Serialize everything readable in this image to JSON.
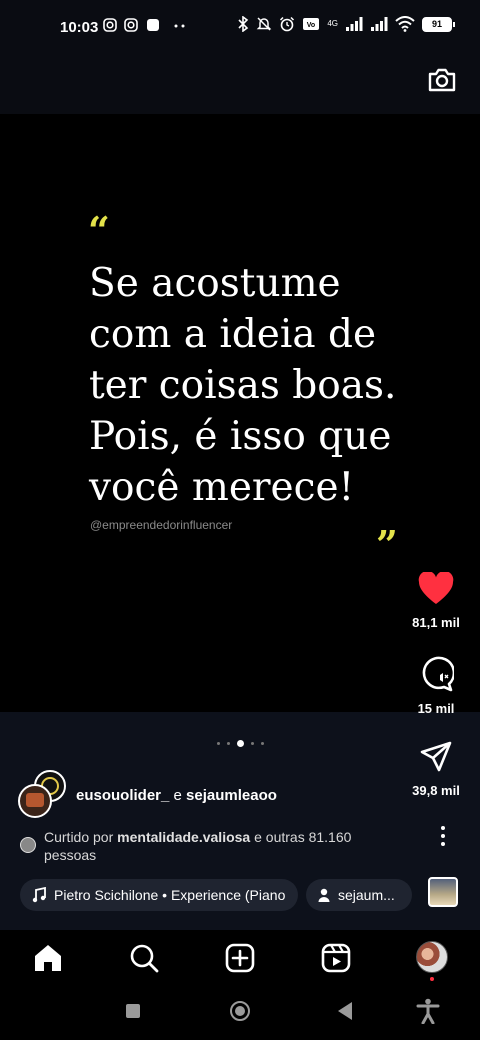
{
  "status_bar": {
    "time": "10:03",
    "network": "4G",
    "battery": "91",
    "icons": [
      "instagram-icon",
      "instagram-icon",
      "app-square-icon",
      "more-dots-icon",
      "bluetooth-icon",
      "silent-icon",
      "alarm-icon",
      "volte-icon",
      "signal-icon",
      "signal-icon",
      "wifi-icon",
      "battery-icon"
    ]
  },
  "post": {
    "quote_text": "Se acostume com a ideia de ter coisas boas. Pois, é isso que você merece!",
    "quote_open": "“",
    "quote_close": "”",
    "handle": "@empreendedorinfluencer",
    "accent_color": "#e3e24a"
  },
  "actions": {
    "likes": "81,1 mil",
    "comments": "15 mil",
    "shares": "39,8 mil",
    "like_color": "#ff3040"
  },
  "carousel": {
    "count": 5,
    "active_index": 2
  },
  "authors": {
    "first": "eusouolider_",
    "connector": "e",
    "second": "sejaumleaoo"
  },
  "liked_by": {
    "prefix": "Curtido por",
    "user": "mentalidade.valiosa",
    "suffix": "e outras 81.160 pessoas"
  },
  "music": {
    "label": "Pietro Scichilone • Experience (Piano",
    "user_tag": "sejaum..."
  },
  "nav": {
    "items": [
      "home-icon",
      "search-icon",
      "create-icon",
      "reels-icon",
      "profile-avatar"
    ]
  }
}
